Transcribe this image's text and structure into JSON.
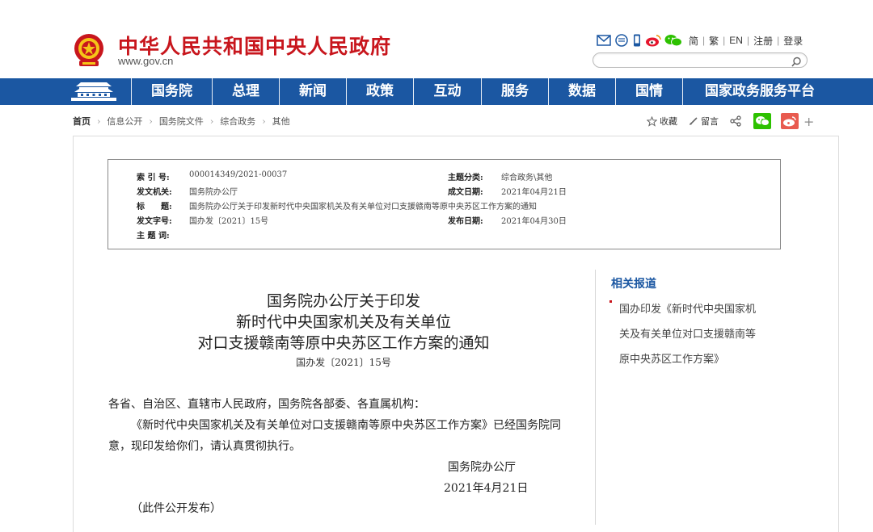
{
  "header": {
    "site_title": "中华人民共和国中央人民政府",
    "site_domain": "www.gov.cn",
    "links": [
      "简",
      "繁",
      "EN",
      "注册",
      "登录"
    ],
    "search_placeholder": ""
  },
  "nav": {
    "items": [
      "国务院",
      "总理",
      "新闻",
      "政策",
      "互动",
      "服务",
      "数据",
      "国情",
      "国家政务服务平台"
    ]
  },
  "breadcrumb": [
    "首页",
    "信息公开",
    "国务院文件",
    "综合政务",
    "其他"
  ],
  "actions": {
    "favorite": "收藏",
    "comment": "留言"
  },
  "info": {
    "index_no_label": "索 引 号:",
    "index_no": "000014349/2021-00037",
    "category_label": "主题分类:",
    "category": "综合政务\\其他",
    "issuer_label": "发文机关:",
    "issuer": "国务院办公厅",
    "created_label": "成文日期:",
    "created": "2021年04月21日",
    "title_label": "标　　题:",
    "title": "国务院办公厅关于印发新时代中央国家机关及有关单位对口支援赣南等原中央苏区工作方案的通知",
    "doc_no_label": "发文字号:",
    "doc_no": "国办发〔2021〕15号",
    "published_label": "发布日期:",
    "published": "2021年04月30日",
    "keywords_label": "主 题 词:"
  },
  "article": {
    "title_lines": [
      "国务院办公厅关于印发",
      "新时代中央国家机关及有关单位",
      "对口支援赣南等原中央苏区工作方案的通知"
    ],
    "doc_number": "国办发〔2021〕15号",
    "salutation": "各省、自治区、直辖市人民政府，国务院各部委、各直属机构：",
    "para1_line1": "《新时代中央国家机关及有关单位对口支援赣南等原中央苏区工作方案》已经国务院同",
    "para1_line2": "意，现印发给你们，请认真贯彻执行。",
    "signature": "国务院办公厅",
    "date": "2021年4月21日",
    "note": "（此件公开发布）"
  },
  "related": {
    "title": "相关报道",
    "item_lines": [
      "国办印发《新时代中央国家机",
      "关及有关单位对口支援赣南等",
      "原中央苏区工作方案》"
    ]
  },
  "colors": {
    "brand_red": "#c8161d",
    "nav_blue": "#1b57a2",
    "wechat_green": "#2dc100",
    "weibo_red": "#e6162d"
  },
  "icons": [
    "national-emblem-icon",
    "mail-icon",
    "chat-icon",
    "mobile-icon",
    "weibo-icon",
    "wechat-icon",
    "search-icon",
    "star-icon",
    "pen-icon",
    "share-icon",
    "plus-icon"
  ]
}
